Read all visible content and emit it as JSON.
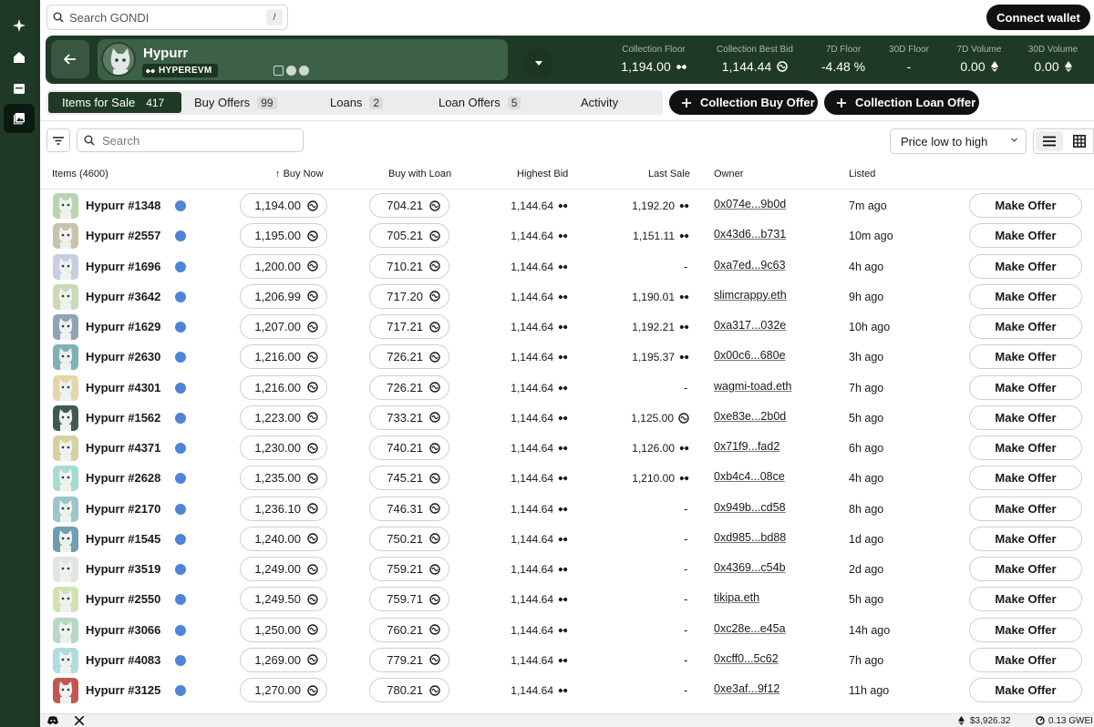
{
  "app": {
    "search_placeholder": "Search GONDI",
    "search_shortcut": "/",
    "connect_label": "Connect wallet"
  },
  "nav": [
    "sparkle-icon",
    "home-icon",
    "store-icon",
    "gallery-icon"
  ],
  "collection": {
    "name": "Hypurr",
    "chain": "HYPEREVM",
    "stats": [
      {
        "label": "Collection Floor",
        "value": "1,194.00",
        "icon": "hype"
      },
      {
        "label": "Collection Best Bid",
        "value": "1,144.44",
        "icon": "whype"
      },
      {
        "label": "7D Floor",
        "value": "-4.48 %",
        "icon": ""
      },
      {
        "label": "30D Floor",
        "value": "-",
        "icon": ""
      },
      {
        "label": "7D Volume",
        "value": "0.00",
        "icon": "eth"
      },
      {
        "label": "30D Volume",
        "value": "0.00",
        "icon": "eth"
      }
    ]
  },
  "tabs": [
    {
      "label": "Items for Sale",
      "count": "417"
    },
    {
      "label": "Buy Offers",
      "count": "99"
    },
    {
      "label": "Loans",
      "count": "2"
    },
    {
      "label": "Loan Offers",
      "count": "5"
    },
    {
      "label": "Activity",
      "count": ""
    }
  ],
  "actions": {
    "buy_offer": "Collection Buy Offer",
    "loan_offer": "Collection Loan Offer"
  },
  "filters": {
    "search_placeholder": "Search",
    "sort": "Price low to high"
  },
  "table": {
    "headers": {
      "items": "Items (4600)",
      "buy_now": "Buy Now",
      "buy_with_loan": "Buy with Loan",
      "highest_bid": "Highest Bid",
      "last_sale": "Last Sale",
      "owner": "Owner",
      "listed": "Listed"
    },
    "action_label": "Make Offer",
    "rows": [
      {
        "name": "Hypurr #1348",
        "buy_now": "1,194.00",
        "loan": "704.21",
        "bid": "1,144.64",
        "last": "1,192.20",
        "last_icon": "hype",
        "owner": "0x074e...9b0d",
        "listed": "7m ago",
        "color": "#b9d4b3"
      },
      {
        "name": "Hypurr #2557",
        "buy_now": "1,195.00",
        "loan": "705.21",
        "bid": "1,144.64",
        "last": "1,151.11",
        "last_icon": "hype",
        "owner": "0x43d6...b731",
        "listed": "10m ago",
        "color": "#c8c3ad"
      },
      {
        "name": "Hypurr #1696",
        "buy_now": "1,200.00",
        "loan": "710.21",
        "bid": "1,144.64",
        "last": "-",
        "last_icon": "",
        "owner": "0xa7ed...9c63",
        "listed": "4h ago",
        "color": "#c5cfe0"
      },
      {
        "name": "Hypurr #3642",
        "buy_now": "1,206.99",
        "loan": "717.20",
        "bid": "1,144.64",
        "last": "1,190.01",
        "last_icon": "hype",
        "owner": "slimcrappy.eth",
        "listed": "9h ago",
        "color": "#c7dbb6"
      },
      {
        "name": "Hypurr #1629",
        "buy_now": "1,207.00",
        "loan": "717.21",
        "bid": "1,144.64",
        "last": "1,192.21",
        "last_icon": "hype",
        "owner": "0xa317...032e",
        "listed": "10h ago",
        "color": "#8fa3b4"
      },
      {
        "name": "Hypurr #2630",
        "buy_now": "1,216.00",
        "loan": "726.21",
        "bid": "1,144.64",
        "last": "1,195.37",
        "last_icon": "hype",
        "owner": "0x00c6...680e",
        "listed": "3h ago",
        "color": "#7fb2b6"
      },
      {
        "name": "Hypurr #4301",
        "buy_now": "1,216.00",
        "loan": "726.21",
        "bid": "1,144.64",
        "last": "-",
        "last_icon": "",
        "owner": "wagmi-toad.eth",
        "listed": "7h ago",
        "color": "#e4d6a9"
      },
      {
        "name": "Hypurr #1562",
        "buy_now": "1,223.00",
        "loan": "733.21",
        "bid": "1,144.64",
        "last": "1,125.00",
        "last_icon": "whype",
        "owner": "0xe83e...2b0d",
        "listed": "5h ago",
        "color": "#3f5a52"
      },
      {
        "name": "Hypurr #4371",
        "buy_now": "1,230.00",
        "loan": "740.21",
        "bid": "1,144.64",
        "last": "1,126.00",
        "last_icon": "hype",
        "owner": "0x71f9...fad2",
        "listed": "6h ago",
        "color": "#d8d19f"
      },
      {
        "name": "Hypurr #2628",
        "buy_now": "1,235.00",
        "loan": "745.21",
        "bid": "1,144.64",
        "last": "1,210.00",
        "last_icon": "hype",
        "owner": "0xb4c4...08ce",
        "listed": "4h ago",
        "color": "#a8dad2"
      },
      {
        "name": "Hypurr #2170",
        "buy_now": "1,236.10",
        "loan": "746.31",
        "bid": "1,144.64",
        "last": "-",
        "last_icon": "",
        "owner": "0x949b...cd58",
        "listed": "8h ago",
        "color": "#9fc4c9"
      },
      {
        "name": "Hypurr #1545",
        "buy_now": "1,240.00",
        "loan": "750.21",
        "bid": "1,144.64",
        "last": "-",
        "last_icon": "",
        "owner": "0xd985...bd88",
        "listed": "1d ago",
        "color": "#6f9db2"
      },
      {
        "name": "Hypurr #3519",
        "buy_now": "1,249.00",
        "loan": "759.21",
        "bid": "1,144.64",
        "last": "-",
        "last_icon": "",
        "owner": "0x4369...c54b",
        "listed": "2d ago",
        "color": "#dfe6e2"
      },
      {
        "name": "Hypurr #2550",
        "buy_now": "1,249.50",
        "loan": "759.71",
        "bid": "1,144.64",
        "last": "-",
        "last_icon": "",
        "owner": "tikipa.eth",
        "listed": "5h ago",
        "color": "#cfe3b2"
      },
      {
        "name": "Hypurr #3066",
        "buy_now": "1,250.00",
        "loan": "760.21",
        "bid": "1,144.64",
        "last": "-",
        "last_icon": "",
        "owner": "0xc28e...e45a",
        "listed": "14h ago",
        "color": "#b8d8c4"
      },
      {
        "name": "Hypurr #4083",
        "buy_now": "1,269.00",
        "loan": "779.21",
        "bid": "1,144.64",
        "last": "-",
        "last_icon": "",
        "owner": "0xcff0...5c62",
        "listed": "7h ago",
        "color": "#b0dbe0"
      },
      {
        "name": "Hypurr #3125",
        "buy_now": "1,270.00",
        "loan": "780.21",
        "bid": "1,144.64",
        "last": "-",
        "last_icon": "",
        "owner": "0xe3af...9f12",
        "listed": "11h ago",
        "color": "#c0584f"
      }
    ]
  },
  "status_bar": {
    "eth_price": "$3,926.32",
    "gas": "0.13 GWEI"
  },
  "colors": {
    "brand_green": "#1e3a26",
    "accent": "#111111"
  }
}
